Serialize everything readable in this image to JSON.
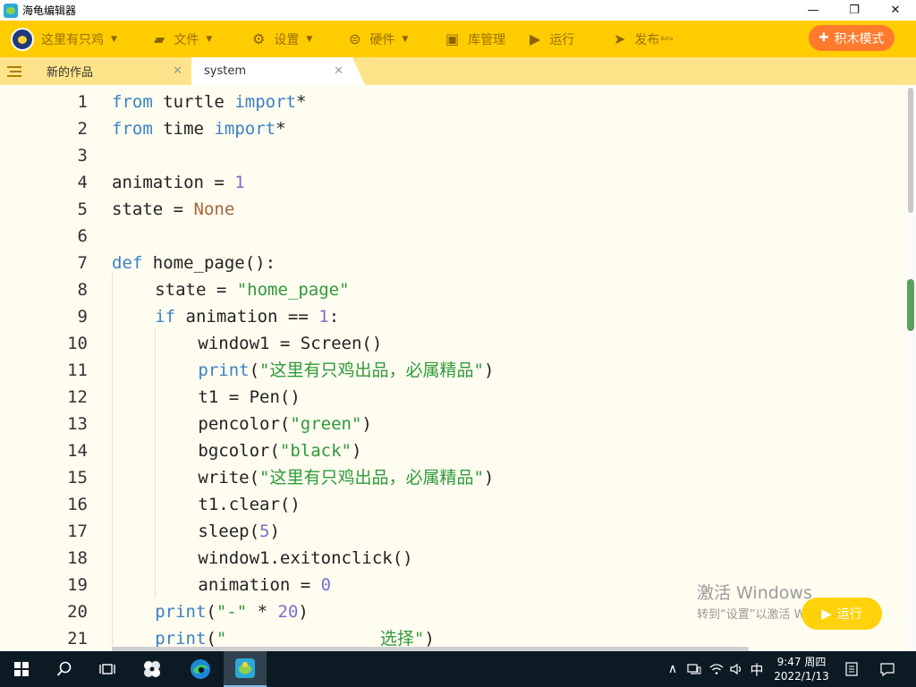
{
  "window": {
    "title": "海龟编辑器",
    "controls": {
      "minimize": "—",
      "maximize": "❐",
      "close": "✕"
    }
  },
  "toolbar": {
    "user_name": "这里有只鸡",
    "file": "文件",
    "settings": "设置",
    "hardware": "硬件",
    "library": "库管理",
    "run": "运行",
    "publish": "发布",
    "publish_badge": "Beta",
    "block_mode": "积木模式",
    "icons": {
      "file": "folder-icon",
      "settings": "gear-icon",
      "hardware": "robot-icon",
      "library": "inbox-icon",
      "run": "play-icon",
      "publish": "paper-plane-icon",
      "block_mode": "puzzle-icon"
    }
  },
  "tabs": [
    {
      "label": "新的作品",
      "close": "✕",
      "active": false
    },
    {
      "label": "system",
      "close": "✕",
      "active": true
    }
  ],
  "editor": {
    "theme": {
      "keyword": "#3b82c4",
      "number": "#7b6fd0",
      "string": "#2f9a3a",
      "constant": "#a7663c",
      "text": "#222222"
    },
    "lines": [
      {
        "n": "1",
        "tokens": [
          [
            "kw",
            "from"
          ],
          [
            "",
            "turtle"
          ],
          [
            "kw",
            "import"
          ],
          [
            "",
            "*"
          ]
        ]
      },
      {
        "n": "2",
        "tokens": [
          [
            "kw",
            "from"
          ],
          [
            "",
            "time"
          ],
          [
            "kw",
            "import"
          ],
          [
            "",
            "*"
          ]
        ]
      },
      {
        "n": "3",
        "tokens": []
      },
      {
        "n": "4",
        "tokens": [
          [
            "",
            "animation = "
          ],
          [
            "num",
            "1"
          ]
        ]
      },
      {
        "n": "5",
        "tokens": [
          [
            "",
            "state = "
          ],
          [
            "cn",
            "None"
          ]
        ]
      },
      {
        "n": "6",
        "tokens": []
      },
      {
        "n": "7",
        "tokens": [
          [
            "kw",
            "def"
          ],
          [
            "",
            "home_page():"
          ]
        ]
      },
      {
        "n": "8",
        "tokens": [
          [
            "",
            "state = "
          ],
          [
            "str",
            "\"home_page\""
          ]
        ]
      },
      {
        "n": "9",
        "tokens": [
          [
            "kw",
            "if"
          ],
          [
            "",
            "animation == "
          ],
          [
            "num",
            "1"
          ],
          [
            "",
            ":"
          ]
        ]
      },
      {
        "n": "10",
        "tokens": [
          [
            "",
            "window1 = Screen()"
          ]
        ]
      },
      {
        "n": "11",
        "tokens": [
          [
            "kw",
            "print"
          ],
          [
            "",
            "("
          ],
          [
            "str",
            "\"这里有只鸡出品，必属精品\""
          ],
          [
            "",
            ")"
          ]
        ]
      },
      {
        "n": "12",
        "tokens": [
          [
            "",
            "t1 = Pen()"
          ]
        ]
      },
      {
        "n": "13",
        "tokens": [
          [
            "",
            "pencolor("
          ],
          [
            "str",
            "\"green\""
          ],
          [
            "",
            ")"
          ]
        ]
      },
      {
        "n": "14",
        "tokens": [
          [
            "",
            "bgcolor("
          ],
          [
            "str",
            "\"black\""
          ],
          [
            "",
            ")"
          ]
        ]
      },
      {
        "n": "15",
        "tokens": [
          [
            "",
            "write("
          ],
          [
            "str",
            "\"这里有只鸡出品，必属精品\""
          ],
          [
            "",
            ")"
          ]
        ]
      },
      {
        "n": "16",
        "tokens": [
          [
            "",
            "t1.clear()"
          ]
        ]
      },
      {
        "n": "17",
        "tokens": [
          [
            "",
            "sleep("
          ],
          [
            "num",
            "5"
          ],
          [
            "",
            ")"
          ]
        ]
      },
      {
        "n": "18",
        "tokens": [
          [
            "",
            "window1.exitonclick()"
          ]
        ]
      },
      {
        "n": "19",
        "tokens": [
          [
            "",
            "animation = "
          ],
          [
            "num",
            "0"
          ]
        ]
      },
      {
        "n": "20",
        "tokens": [
          [
            "kw",
            "print"
          ],
          [
            "",
            "("
          ],
          [
            "str",
            "\"-\""
          ],
          [
            "",
            " * "
          ],
          [
            "num",
            "20"
          ],
          [
            "",
            ")"
          ]
        ]
      },
      {
        "n": "21",
        "tokens": [
          [
            "kw",
            "print"
          ],
          [
            "",
            "("
          ],
          [
            "str",
            "\"               选择\""
          ],
          [
            "",
            ")"
          ]
        ]
      }
    ]
  },
  "run_fab": "运行",
  "watermark": {
    "title": "激活 Windows",
    "subtitle": "转到“设置”以激活 Windows。"
  },
  "taskbar": {
    "apps": [
      "windows-start-icon",
      "search-icon",
      "task-view-icon",
      "pinwheel-app-icon",
      "edge-browser-icon",
      "turtle-editor-icon"
    ],
    "ime": "中",
    "time": "9:47 周四",
    "date": "2022/1/13"
  }
}
